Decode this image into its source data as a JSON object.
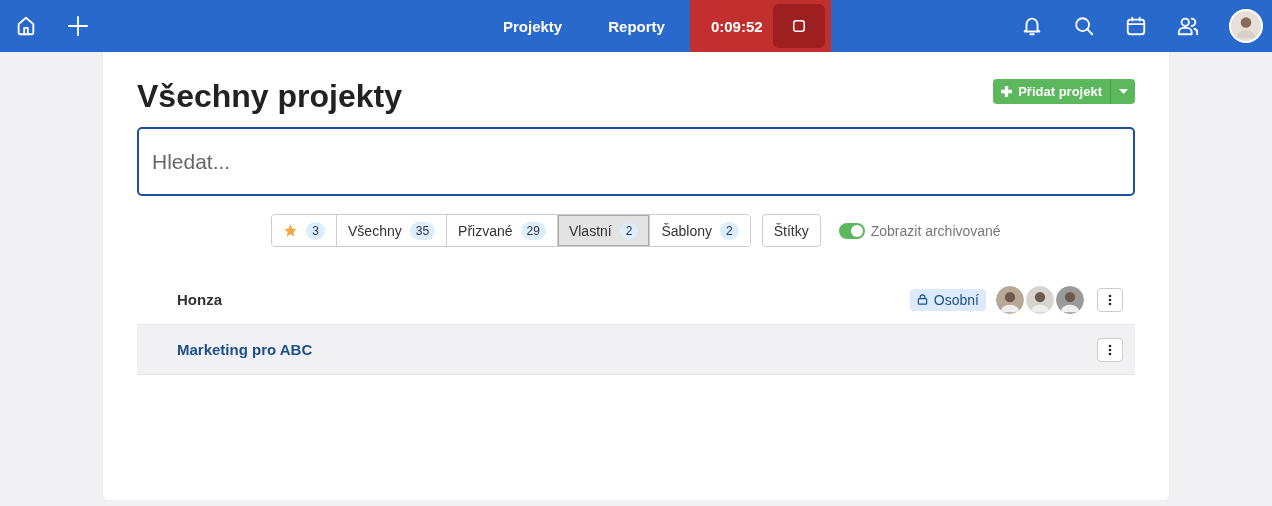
{
  "top_bar": {
    "nav_items": [
      {
        "label": "Projekty"
      },
      {
        "label": "Reporty"
      }
    ],
    "timer": {
      "time": "0:09:52",
      "running": true
    }
  },
  "page": {
    "title": "Všechny projekty",
    "add_button": {
      "label": "Přidat projekt"
    },
    "search": {
      "placeholder": "Hledat..."
    },
    "filters": [
      {
        "kind": "star",
        "count": "3",
        "selected": false
      },
      {
        "kind": "text",
        "label": "Všechny",
        "count": "35",
        "selected": false
      },
      {
        "kind": "text",
        "label": "Přizvané",
        "count": "29",
        "selected": false
      },
      {
        "kind": "text",
        "label": "Vlastní",
        "count": "2",
        "selected": true
      },
      {
        "kind": "text",
        "label": "Šablony",
        "count": "2",
        "selected": false
      }
    ],
    "tags_button": {
      "label": "Štítky"
    },
    "archive_toggle": {
      "label": "Zobrazit archivované",
      "on": true
    },
    "projects": [
      {
        "name": "Honza",
        "highlighted": false,
        "tag": "Osobní",
        "members": [
          {
            "kind": "avatar"
          },
          {
            "kind": "avatar"
          },
          {
            "kind": "avatar"
          }
        ]
      },
      {
        "name": "Marketing pro ABC",
        "highlighted": true
      }
    ]
  }
}
